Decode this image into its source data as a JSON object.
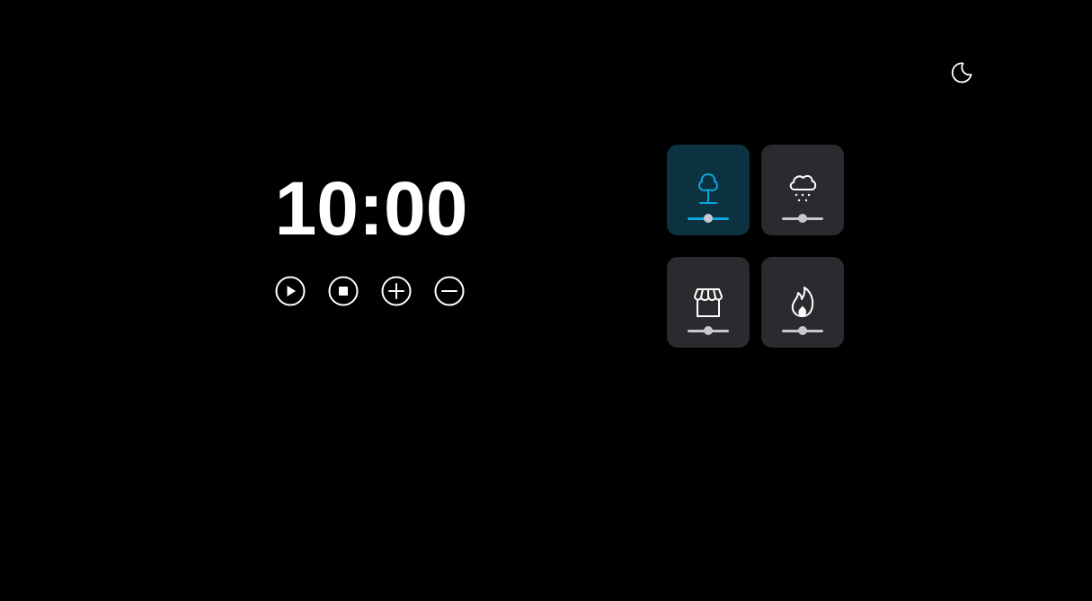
{
  "header": {
    "theme_icon": "moon-icon"
  },
  "timer": {
    "display": "10:00"
  },
  "controls": [
    {
      "icon": "play-icon"
    },
    {
      "icon": "stop-icon"
    },
    {
      "icon": "plus-icon"
    },
    {
      "icon": "minus-icon"
    }
  ],
  "sounds": [
    {
      "icon": "tree-icon",
      "active": true,
      "volume": 0.5
    },
    {
      "icon": "snow-cloud-icon",
      "active": false,
      "volume": 0.5
    },
    {
      "icon": "store-icon",
      "active": false,
      "volume": 0.5
    },
    {
      "icon": "fire-icon",
      "active": false,
      "volume": 0.5
    }
  ],
  "colors": {
    "background": "#000000",
    "tile": "#2b2a2e",
    "tile_active": "#0c3241",
    "accent": "#0aa7e0",
    "icon": "#ffffff"
  }
}
